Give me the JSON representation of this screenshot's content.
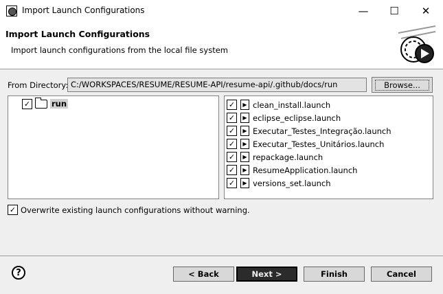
{
  "window": {
    "title": "Import Launch Configurations",
    "minimize_glyph": "—",
    "maximize_glyph": "☐",
    "close_glyph": "✕"
  },
  "banner": {
    "title": "Import Launch Configurations",
    "description": "Import launch configurations from the local file system",
    "image_icon": "import-wizard-icon"
  },
  "from_directory": {
    "label": "From Directory:",
    "value": "C:/WORKSPACES/RESUME/RESUME-API/resume-api/.github/docs/run",
    "browse_label": "Browse..."
  },
  "tree": {
    "items": [
      {
        "label": "run",
        "checked": true,
        "icon": "folder-icon"
      }
    ]
  },
  "launch_files": [
    {
      "label": "clean_install.launch",
      "checked": true
    },
    {
      "label": "eclipse_eclipse.launch",
      "checked": true
    },
    {
      "label": "Executar_Testes_Integração.launch",
      "checked": true
    },
    {
      "label": "Executar_Testes_Unitários.launch",
      "checked": true
    },
    {
      "label": "repackage.launch",
      "checked": true
    },
    {
      "label": "ResumeApplication.launch",
      "checked": true
    },
    {
      "label": "versions_set.launch",
      "checked": true
    }
  ],
  "overwrite": {
    "label": "Overwrite existing launch configurations without warning.",
    "checked": true
  },
  "footer": {
    "help_glyph": "?",
    "back_label": "< Back",
    "next_label": "Next >",
    "finish_label": "Finish",
    "cancel_label": "Cancel"
  }
}
